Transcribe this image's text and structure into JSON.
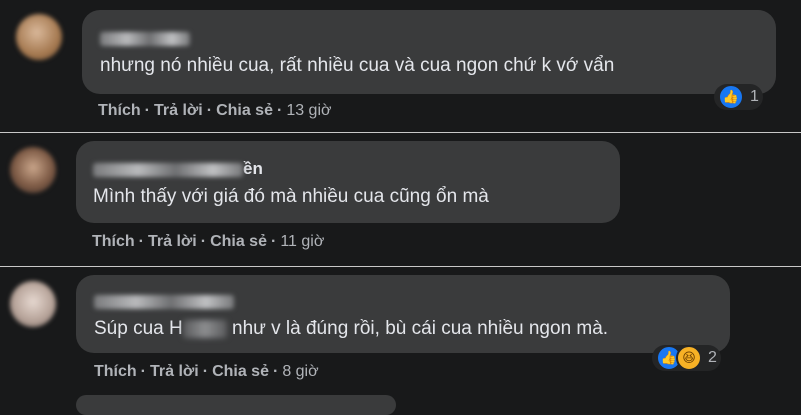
{
  "colors": {
    "background": "#18191a",
    "bubble": "#3a3b3c",
    "like": "#1877f2",
    "haha": "#f7b125",
    "separator": "#c8c8c8"
  },
  "comments": [
    {
      "name_suffix": "",
      "text": "nhưng nó nhiều cua, rất nhiều cua và cua ngon chứ k vớ vẩn",
      "actions": {
        "like": "Thích",
        "reply": "Trả lời",
        "share": "Chia sẻ"
      },
      "time": "13 giờ",
      "reactions": {
        "icons": [
          "like-icon"
        ],
        "count": "1"
      }
    },
    {
      "name_suffix": "ền",
      "text": "Mình thấy với giá đó mà nhiều cua cũng ổn mà",
      "actions": {
        "like": "Thích",
        "reply": "Trả lời",
        "share": "Chia sẻ"
      },
      "time": "11 giờ"
    },
    {
      "name_suffix": "",
      "text_before": "Súp cua H",
      "text_after": " như v là đúng rồi, bù cái cua nhiều ngon mà.",
      "actions": {
        "like": "Thích",
        "reply": "Trả lời",
        "share": "Chia sẻ"
      },
      "time": "8 giờ",
      "reactions": {
        "icons": [
          "like-icon",
          "haha-icon"
        ],
        "count": "2"
      }
    }
  ]
}
